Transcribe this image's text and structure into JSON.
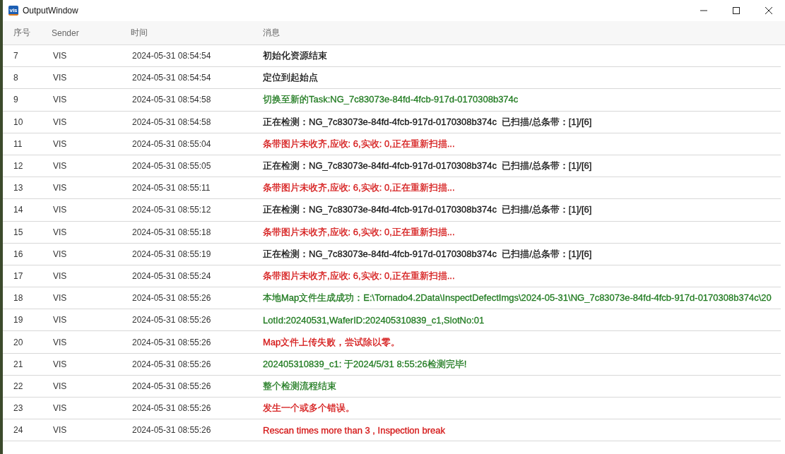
{
  "window": {
    "title": "OutputWindow",
    "icon_text": "vis"
  },
  "table": {
    "columns": [
      "序号",
      "Sender",
      "时间",
      "消息"
    ],
    "rows": [
      {
        "index": "7",
        "sender": "VIS",
        "time": "2024-05-31 08:54:54",
        "message": "初始化资源结束",
        "color": "#111111"
      },
      {
        "index": "8",
        "sender": "VIS",
        "time": "2024-05-31 08:54:54",
        "message": "定位到起始点",
        "color": "#111111"
      },
      {
        "index": "9",
        "sender": "VIS",
        "time": "2024-05-31 08:54:58",
        "message": "切换至新的Task:NG_7c83073e-84fd-4fcb-917d-0170308b374c",
        "color": "#1f7a1f"
      },
      {
        "index": "10",
        "sender": "VIS",
        "time": "2024-05-31 08:54:58",
        "message": "正在检测：NG_7c83073e-84fd-4fcb-917d-0170308b374c  已扫描/总条带：[1]/[6]",
        "color": "#111111"
      },
      {
        "index": "11",
        "sender": "VIS",
        "time": "2024-05-31 08:55:04",
        "message": "条带图片未收齐,应收: 6,实收: 0,正在重新扫描...",
        "color": "#d41414"
      },
      {
        "index": "12",
        "sender": "VIS",
        "time": "2024-05-31 08:55:05",
        "message": "正在检测：NG_7c83073e-84fd-4fcb-917d-0170308b374c  已扫描/总条带：[1]/[6]",
        "color": "#111111"
      },
      {
        "index": "13",
        "sender": "VIS",
        "time": "2024-05-31 08:55:11",
        "message": "条带图片未收齐,应收: 6,实收: 0,正在重新扫描...",
        "color": "#d41414"
      },
      {
        "index": "14",
        "sender": "VIS",
        "time": "2024-05-31 08:55:12",
        "message": "正在检测：NG_7c83073e-84fd-4fcb-917d-0170308b374c  已扫描/总条带：[1]/[6]",
        "color": "#111111"
      },
      {
        "index": "15",
        "sender": "VIS",
        "time": "2024-05-31 08:55:18",
        "message": "条带图片未收齐,应收: 6,实收: 0,正在重新扫描...",
        "color": "#d41414"
      },
      {
        "index": "16",
        "sender": "VIS",
        "time": "2024-05-31 08:55:19",
        "message": "正在检测：NG_7c83073e-84fd-4fcb-917d-0170308b374c  已扫描/总条带：[1]/[6]",
        "color": "#111111"
      },
      {
        "index": "17",
        "sender": "VIS",
        "time": "2024-05-31 08:55:24",
        "message": "条带图片未收齐,应收: 6,实收: 0,正在重新扫描...",
        "color": "#d41414"
      },
      {
        "index": "18",
        "sender": "VIS",
        "time": "2024-05-31 08:55:26",
        "message": "本地Map文件生成成功：E:\\Tornado4.2Data\\InspectDefectImgs\\2024-05-31\\NG_7c83073e-84fd-4fcb-917d-0170308b374c\\20",
        "color": "#1f7a1f"
      },
      {
        "index": "19",
        "sender": "VIS",
        "time": "2024-05-31 08:55:26",
        "message": "LotId:20240531,WaferID:202405310839_c1,SlotNo:01",
        "color": "#1f7a1f"
      },
      {
        "index": "20",
        "sender": "VIS",
        "time": "2024-05-31 08:55:26",
        "message": "Map文件上传失败，尝试除以零。",
        "color": "#d41414"
      },
      {
        "index": "21",
        "sender": "VIS",
        "time": "2024-05-31 08:55:26",
        "message": "202405310839_c1: 于2024/5/31 8:55:26检测完毕!",
        "color": "#1f7a1f"
      },
      {
        "index": "22",
        "sender": "VIS",
        "time": "2024-05-31 08:55:26",
        "message": "整个检测流程结束",
        "color": "#1f7a1f"
      },
      {
        "index": "23",
        "sender": "VIS",
        "time": "2024-05-31 08:55:26",
        "message": "发生一个或多个错误。",
        "color": "#d41414"
      },
      {
        "index": "24",
        "sender": "VIS",
        "time": "2024-05-31 08:55:26",
        "message": "Rescan times more than 3 , Inspection break",
        "color": "#d41414"
      }
    ]
  }
}
